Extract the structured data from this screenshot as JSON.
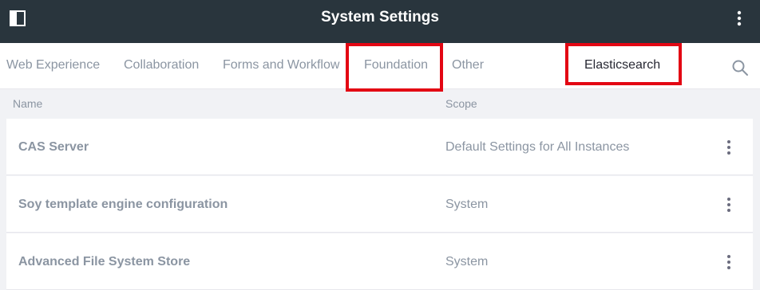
{
  "header": {
    "title": "System Settings",
    "panel_icon": "sidebar-toggle-icon",
    "menu_icon": "vertical-ellipsis-icon"
  },
  "nav": {
    "tabs": [
      {
        "label": "Web Experience"
      },
      {
        "label": "Collaboration"
      },
      {
        "label": "Forms and Workflow"
      },
      {
        "label": "Foundation"
      },
      {
        "label": "Other"
      },
      {
        "label": "Elasticsearch"
      }
    ],
    "active_tab": "Elasticsearch",
    "highlighted_tabs": [
      "Foundation",
      "Elasticsearch"
    ],
    "search_icon": "search-icon"
  },
  "table": {
    "columns": {
      "name": "Name",
      "scope": "Scope"
    },
    "rows": [
      {
        "name": "CAS Server",
        "scope": "Default Settings for All Instances"
      },
      {
        "name": "Soy template engine configuration",
        "scope": "System"
      },
      {
        "name": "Advanced File System Store",
        "scope": "System"
      }
    ]
  },
  "colors": {
    "header_bg": "#29353d",
    "highlight": "#e30613",
    "muted_text": "#8b95a2",
    "active_text": "#272833"
  }
}
